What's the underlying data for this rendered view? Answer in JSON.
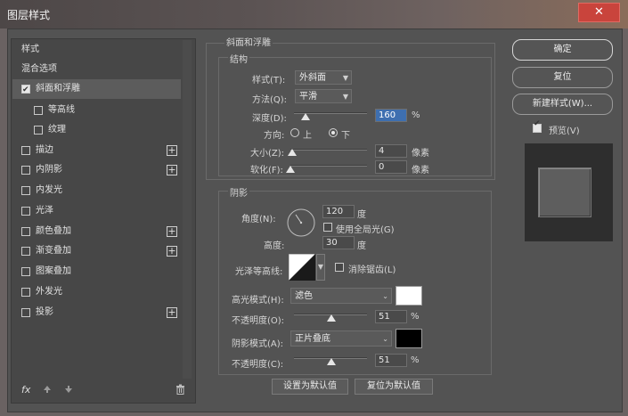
{
  "window": {
    "title": "图层样式",
    "close_icon": "✕"
  },
  "sidebar": {
    "items": [
      {
        "label": "样式",
        "checkbox": false,
        "plus": false
      },
      {
        "label": "混合选项",
        "checkbox": false,
        "plus": false
      },
      {
        "label": "斜面和浮雕",
        "checkbox": true,
        "checked": true,
        "plus": false
      },
      {
        "label": "等高线",
        "checkbox": true,
        "checked": false,
        "plus": false
      },
      {
        "label": "纹理",
        "checkbox": true,
        "checked": false,
        "plus": false
      },
      {
        "label": "描边",
        "checkbox": true,
        "checked": false,
        "plus": true
      },
      {
        "label": "内阴影",
        "checkbox": true,
        "checked": false,
        "plus": true
      },
      {
        "label": "内发光",
        "checkbox": true,
        "checked": false,
        "plus": false
      },
      {
        "label": "光泽",
        "checkbox": true,
        "checked": false,
        "plus": false
      },
      {
        "label": "颜色叠加",
        "checkbox": true,
        "checked": false,
        "plus": true
      },
      {
        "label": "渐变叠加",
        "checkbox": true,
        "checked": false,
        "plus": true
      },
      {
        "label": "图案叠加",
        "checkbox": true,
        "checked": false,
        "plus": false
      },
      {
        "label": "外发光",
        "checkbox": true,
        "checked": false,
        "plus": false
      },
      {
        "label": "投影",
        "checkbox": true,
        "checked": false,
        "plus": true
      }
    ],
    "footer": {
      "fx": "fx",
      "up_icon": "arrow-up-icon",
      "down_icon": "arrow-down-icon",
      "trash_icon": "trash-icon"
    }
  },
  "bevel": {
    "section_title": "斜面和浮雕",
    "structure_title": "结构",
    "style_label": "样式(T):",
    "style_value": "外斜面",
    "technique_label": "方法(Q):",
    "technique_value": "平滑",
    "depth_label": "深度(D):",
    "depth_value": "160",
    "depth_unit": "%",
    "direction_label": "方向:",
    "direction_up": "上",
    "direction_down": "下",
    "direction_selected": "下",
    "size_label": "大小(Z):",
    "size_value": "4",
    "size_unit": "像素",
    "soften_label": "软化(F):",
    "soften_value": "0",
    "soften_unit": "像素"
  },
  "shading": {
    "title": "阴影",
    "angle_label": "角度(N):",
    "angle_value": "120",
    "angle_unit": "度",
    "global_light_label": "使用全局光(G)",
    "altitude_label": "高度:",
    "altitude_value": "30",
    "altitude_unit": "度",
    "gloss_label": "光泽等高线:",
    "antialias_label": "消除锯齿(L)",
    "highlight_label": "高光模式(H):",
    "highlight_mode": "滤色",
    "highlight_color": "#ffffff",
    "highlight_opacity_label": "不透明度(O):",
    "highlight_opacity": "51",
    "shadow_label": "阴影模式(A):",
    "shadow_mode": "正片叠底",
    "shadow_color": "#000000",
    "shadow_opacity_label": "不透明度(C):",
    "shadow_opacity": "51",
    "percent": "%"
  },
  "bottom": {
    "make_default": "设置为默认值",
    "reset_default": "复位为默认值"
  },
  "right": {
    "ok": "确定",
    "reset": "复位",
    "new_style": "新建样式(W)...",
    "preview_label": "预览(V)",
    "preview_checked": true
  },
  "levels": {
    "depth": 0.16,
    "size": 0.02,
    "soften": 0.0,
    "highlight_opacity": 0.51,
    "shadow_opacity": 0.51
  },
  "colors": {
    "accent_selected_input": "#3e6fb0",
    "dialog_bg": "#535353"
  }
}
